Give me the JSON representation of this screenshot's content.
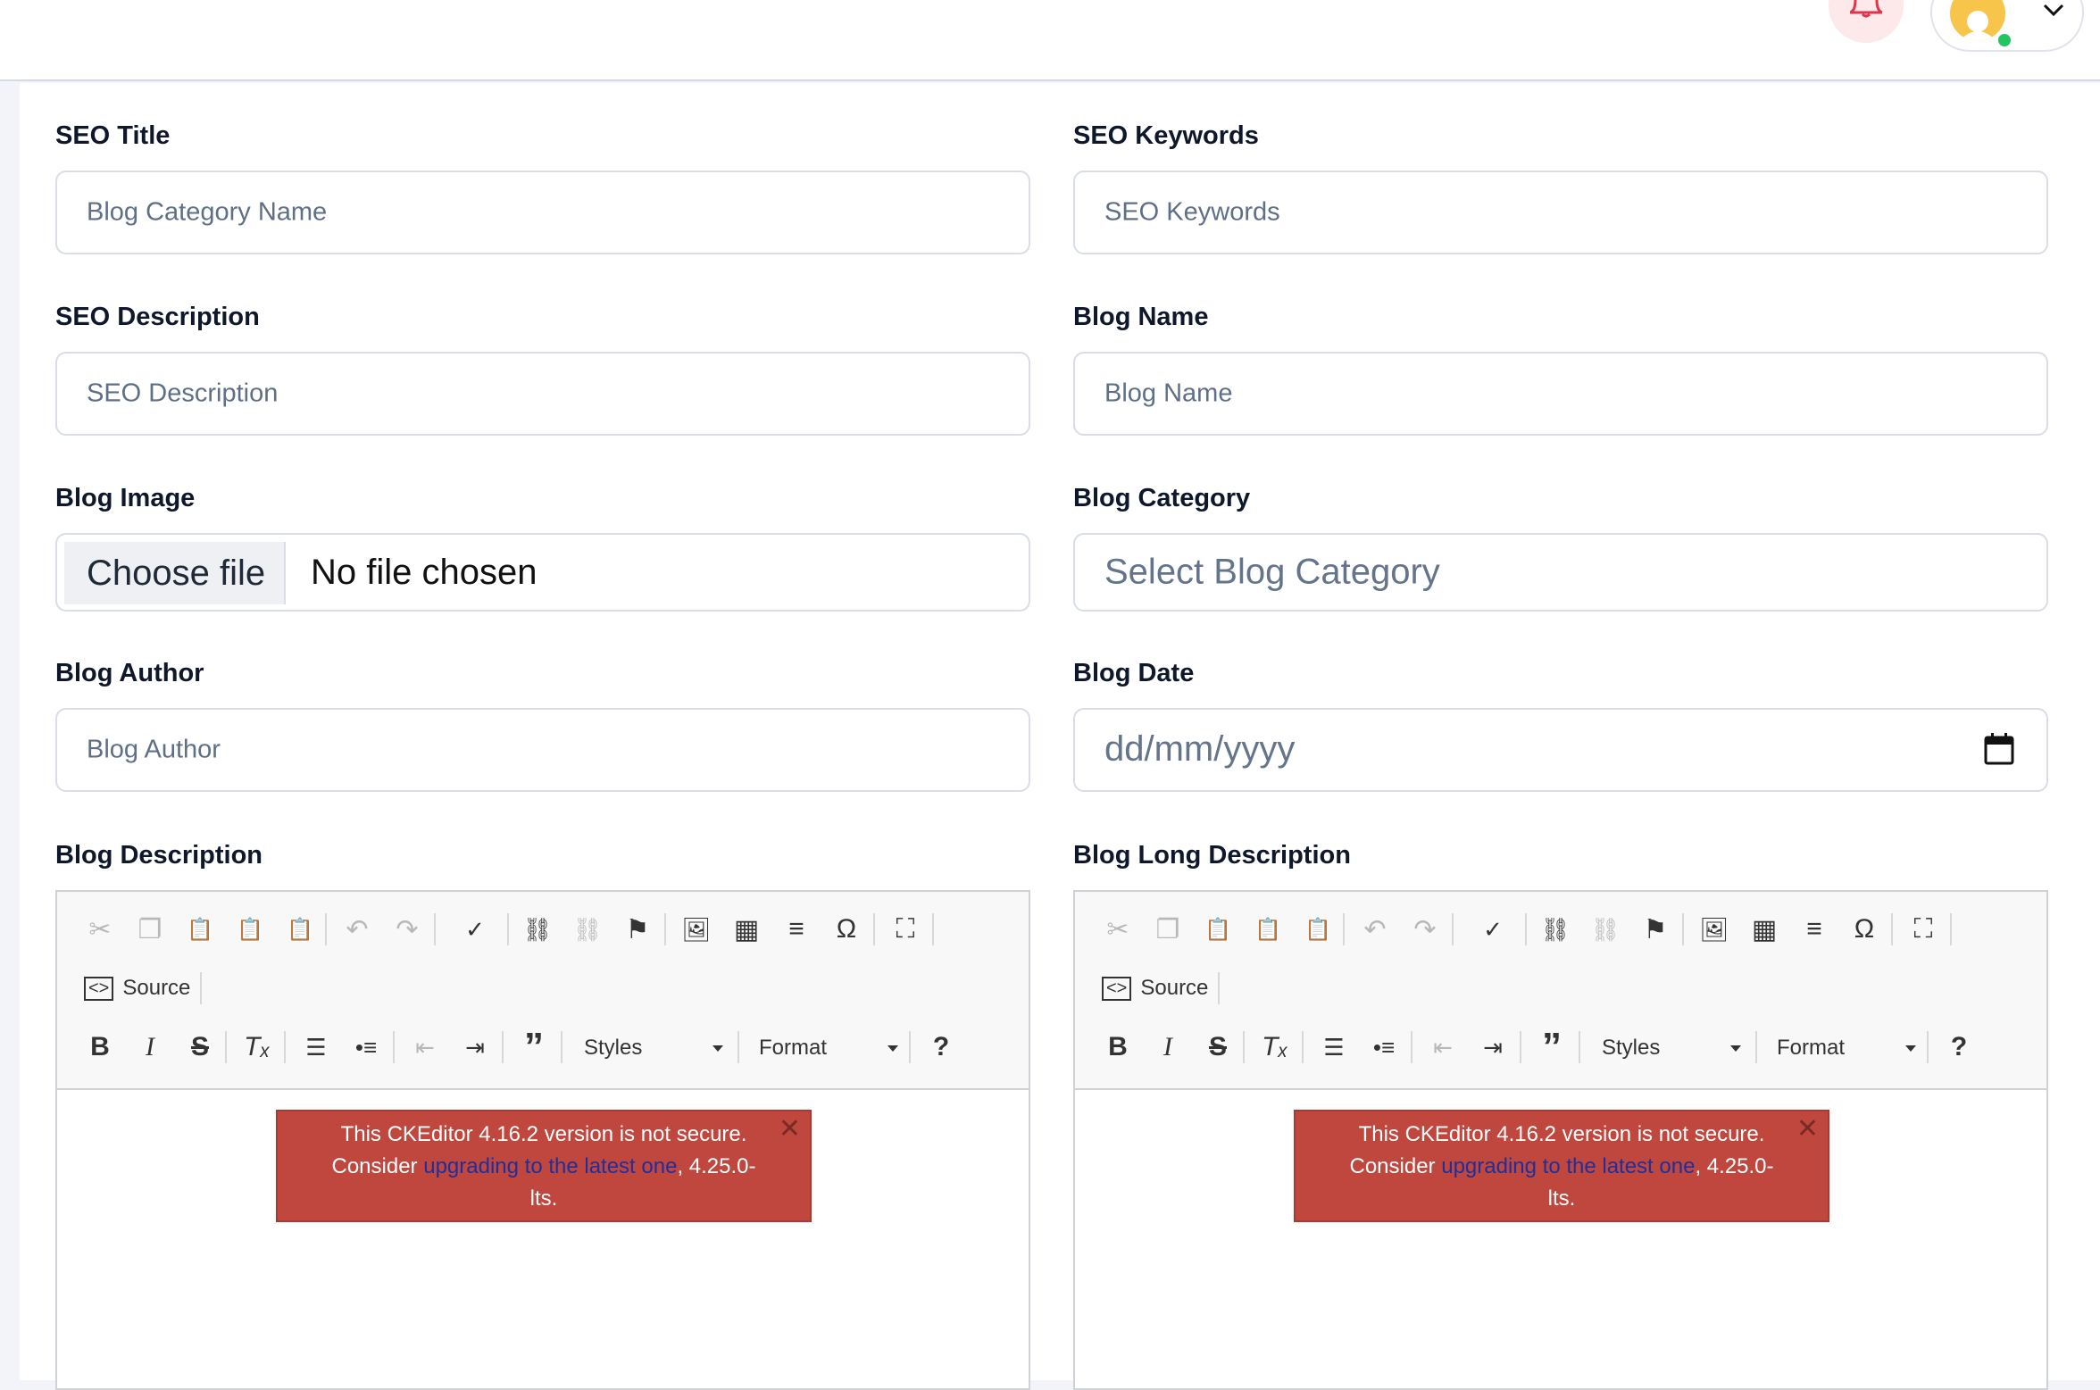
{
  "header": {
    "bell_icon": "bell-icon",
    "avatar_icon": "user-avatar",
    "status": "online",
    "menu_icon": "chevron-down-icon"
  },
  "form": {
    "seo_title": {
      "label": "SEO Title",
      "placeholder": "Blog Category Name"
    },
    "seo_keywords": {
      "label": "SEO Keywords",
      "placeholder": "SEO Keywords"
    },
    "seo_description": {
      "label": "SEO Description",
      "placeholder": "SEO Description"
    },
    "blog_name": {
      "label": "Blog Name",
      "placeholder": "Blog Name"
    },
    "blog_image": {
      "label": "Blog Image",
      "button": "Choose file",
      "status": "No file chosen"
    },
    "blog_category": {
      "label": "Blog Category",
      "placeholder": "Select Blog Category"
    },
    "blog_author": {
      "label": "Blog Author",
      "placeholder": "Blog Author"
    },
    "blog_date": {
      "label": "Blog Date",
      "placeholder": "dd/mm/yyyy"
    },
    "blog_description": {
      "label": "Blog Description"
    },
    "blog_long_description": {
      "label": "Blog Long Description"
    }
  },
  "editor": {
    "source_label": "Source",
    "styles_label": "Styles",
    "format_label": "Format",
    "help_label": "?",
    "warning": {
      "line1": "This CKEditor 4.16.2 version is not secure.",
      "prefix": "Consider ",
      "link": "upgrading to the latest one",
      "suffix": ", 4.25.0-",
      "line3": "lts."
    }
  },
  "colors": {
    "warning_bg": "#c0473e",
    "link": "#1e2f9c",
    "online": "#22c55e"
  }
}
